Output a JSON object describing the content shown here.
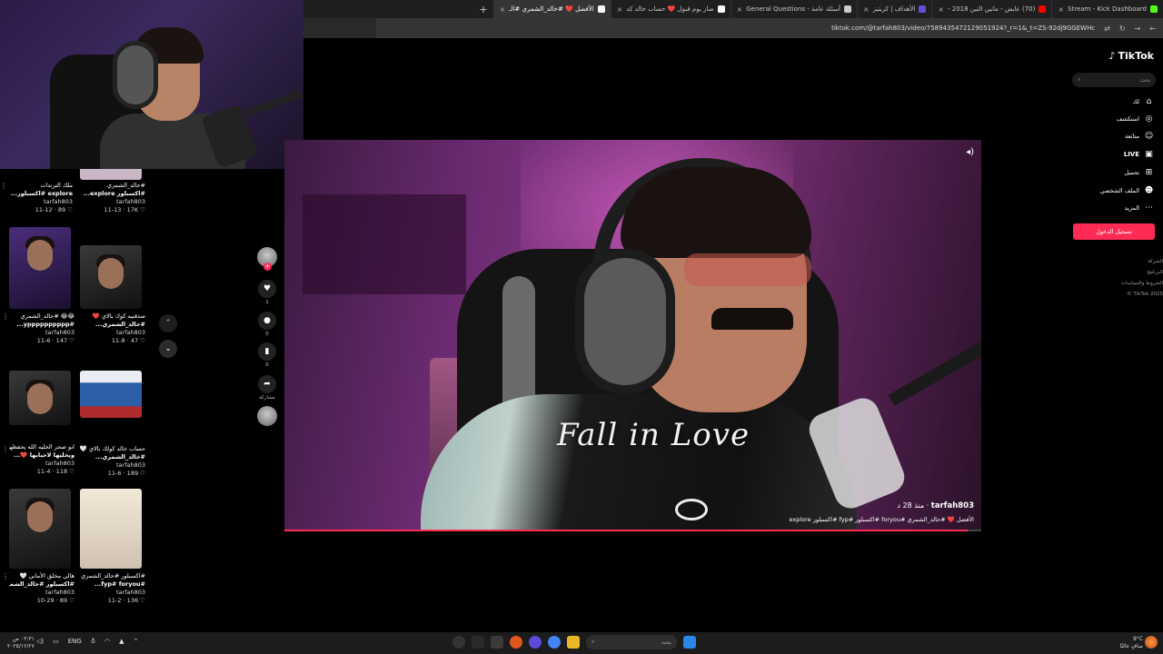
{
  "browser": {
    "tabs": [
      {
        "label": "Stream - Kick Dashboard",
        "active": false,
        "color": "#53fc18"
      },
      {
        "label": "(70) عايض - ماتين التين 2018 -",
        "active": false,
        "color": "#ff0000"
      },
      {
        "label": "الأهداف | كريتيز",
        "active": false,
        "color": "#6a4bd8"
      },
      {
        "label": "أسئلة عامة - General Questions",
        "active": false,
        "color": "#cccccc"
      },
      {
        "label": "صار يوم قبول ❤️ حساب خالد كد",
        "active": false,
        "color": "#ffffff"
      },
      {
        "label": "الأفضل ❤️ #خالد_الشمري #الـ",
        "active": true,
        "color": "#ffffff"
      }
    ],
    "new_tab": "+",
    "url": "tiktok.com/@tarfah803/video/7589435472129051924?_r=1&_t=ZS-92dj9GGEWHc"
  },
  "grid": {
    "items": [
      {
        "caption1": "#خالد_الشمري",
        "caption2": "#اكسبلور explore...",
        "user": "tarfah803",
        "stats": "11-13 · 17K ♡",
        "thumb": "t-purple"
      },
      {
        "caption1": "ملك الترندات",
        "caption2": "explore #اكسبلور...",
        "user": "tarfah803",
        "stats": "11-12 · 89 ♡",
        "thumb": "t-purple"
      },
      {
        "caption1": "صدقنيه كوك بالاي ❤️",
        "caption2": "#خالد_الشمري...",
        "user": "tarfah803",
        "stats": "11-8 · 47 ♡",
        "thumb": "t-dark"
      },
      {
        "caption1": "😂😂 #خالد_الشمري",
        "caption2": "#ypppppppppp...",
        "user": "tarfah803",
        "stats": "11-6 · 147 ♡",
        "thumb": "t-purple"
      },
      {
        "caption1": "حساب خالد كولك بالاي 🤍",
        "caption2": "#خالد_الشمري...",
        "user": "tarfah803",
        "stats": "11-6 · 189 ♡",
        "thumb": "t-blue"
      },
      {
        "caption1": "ابو صحر الخليه الله يحفظها",
        "caption2": "ويخليها لاحبابها ❤️...",
        "user": "tarfah803",
        "stats": "11-4 · 118 ♡",
        "thumb": "t-dark"
      },
      {
        "caption1": "#اكسبلور #خالد_الشمري",
        "caption2": "#fyp# foryou...",
        "user": "tarfah803",
        "stats": "11-2 · 136 ♡",
        "thumb": "t-light"
      },
      {
        "caption1": "هالي مخلق الأماني 🤍",
        "caption2": "#اكسبلور #خالد_الشمـ...",
        "user": "tarfah803",
        "stats": "10-29 · 89 ♡",
        "thumb": "t-dark"
      }
    ]
  },
  "nav_arrows": {
    "up": "⌃",
    "down": "⌄"
  },
  "actions": {
    "like_count": "1",
    "comment_count": "0",
    "save_count": "0",
    "share_label": "مشاركة"
  },
  "video": {
    "overlay_text": "Fall in Love",
    "author": "tarfah803",
    "age": "· منذ 28 د",
    "description": "الأفضل ❤️ #خالد_الشمري #foryou #اكسبلور #fyp #اكسبلور explore",
    "progress": 0.98
  },
  "tiktok": {
    "logo": "TikTok",
    "search_placeholder": "بحث",
    "nav": [
      {
        "label": "لك",
        "icon": "⌂",
        "name": "home"
      },
      {
        "label": "استكشف",
        "icon": "◎",
        "name": "explore"
      },
      {
        "label": "متابَعة",
        "icon": "☺",
        "name": "following"
      },
      {
        "label": "LIVE",
        "icon": "▣",
        "name": "live"
      },
      {
        "label": "تحميل",
        "icon": "⊞",
        "name": "upload"
      },
      {
        "label": "الملف الشخصي",
        "icon": "☻",
        "name": "profile"
      },
      {
        "label": "المزيد",
        "icon": "⋯",
        "name": "more"
      }
    ],
    "login_label": "تسجيل الدخول",
    "footer": [
      "الشركة",
      "البرنامج",
      "الشروط والسياسات",
      "© TikTok 2025"
    ],
    "brand_color": "#fe2c55"
  },
  "taskbar": {
    "clock_time": "٠٣:٣١ ص",
    "clock_date": "٢٠٢٥/١٢/٢٧",
    "lang": "ENG",
    "search_placeholder": "بحث",
    "weather_temp": "9°C",
    "weather_desc": "صافٍ غالبًا"
  }
}
